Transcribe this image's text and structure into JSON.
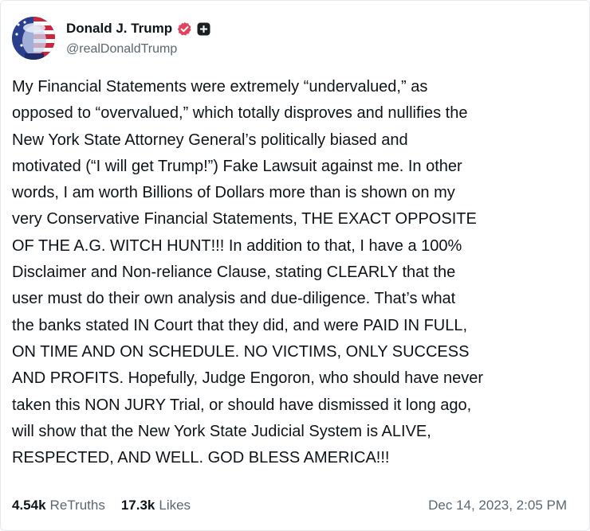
{
  "post": {
    "author": {
      "display_name": "Donald J. Trump",
      "handle": "@realDonaldTrump",
      "verified_icon": "verified-badge-icon",
      "plus_icon": "plus-badge-icon",
      "verified_color": "#e0435d"
    },
    "text_lines": [
      "My Financial Statements were extremely “undervalued,” as",
      "opposed to “overvalued,” which totally disproves and nullifies the",
      "New York State Attorney General’s politically biased and",
      "motivated (“I will get Trump!”) Fake Lawsuit against me. In other",
      "words, I am worth Billions of Dollars more than is shown on my",
      "very Conservative Financial Statements, THE EXACT OPPOSITE",
      "OF THE A.G. WITCH HUNT!!! In addition to that, I have a 100%",
      "Disclaimer and Non-reliance Clause, stating CLEARLY that the",
      "user must do their own analysis and due-diligence. That’s what",
      "the banks stated IN Court that they did, and were PAID IN FULL,",
      "ON TIME AND ON SCHEDULE. NO VICTIMS, ONLY SUCCESS",
      "AND PROFITS. Hopefully, Judge Engoron, who should have never",
      "taken this NON JURY Trial, or should have dismissed it long ago,",
      "will show that the New York State Judicial System is ALIVE,",
      "RESPECTED, AND WELL. GOD BLESS AMERICA!!!"
    ],
    "stats": {
      "retruths_count": "4.54k",
      "retruths_label": "ReTruths",
      "likes_count": "17.3k",
      "likes_label": "Likes"
    },
    "timestamp": "Dec 14, 2023, 2:05 PM"
  }
}
